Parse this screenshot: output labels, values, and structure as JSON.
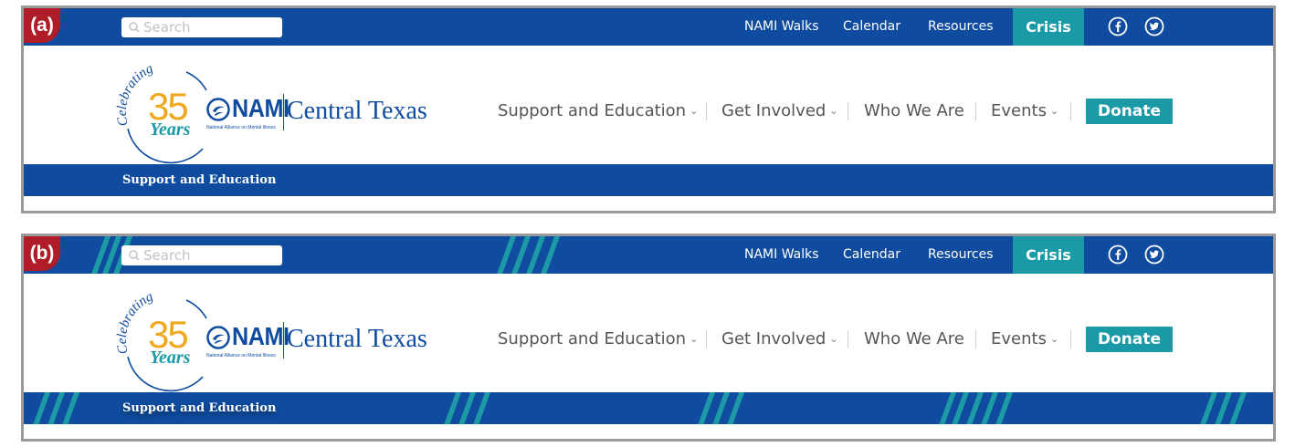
{
  "panels": [
    {
      "label": "(a)"
    },
    {
      "label": "(b)"
    }
  ],
  "search": {
    "placeholder": "Search",
    "icon": "search-icon"
  },
  "topnav": {
    "links": [
      "NAMI Walks",
      "Calendar",
      "Resources"
    ],
    "crisis": "Crisis"
  },
  "social": {
    "icons": [
      "facebook-icon",
      "twitter-icon"
    ]
  },
  "logo": {
    "celebrating": "Celebrating",
    "number": "35",
    "years": "Years",
    "nami": "NAMI",
    "nami_sub": "National Alliance on Mental Illness",
    "affiliate": "Central Texas"
  },
  "mainnav": {
    "items": [
      "Support and Education",
      "Get Involved",
      "Who We Are",
      "Events"
    ],
    "donate": "Donate"
  },
  "subbar": {
    "title": "Support and Education"
  },
  "colors": {
    "navy": "#0f4c9f",
    "teal": "#1a9aa6",
    "gold": "#f0a81f",
    "badge": "#b01c27"
  }
}
